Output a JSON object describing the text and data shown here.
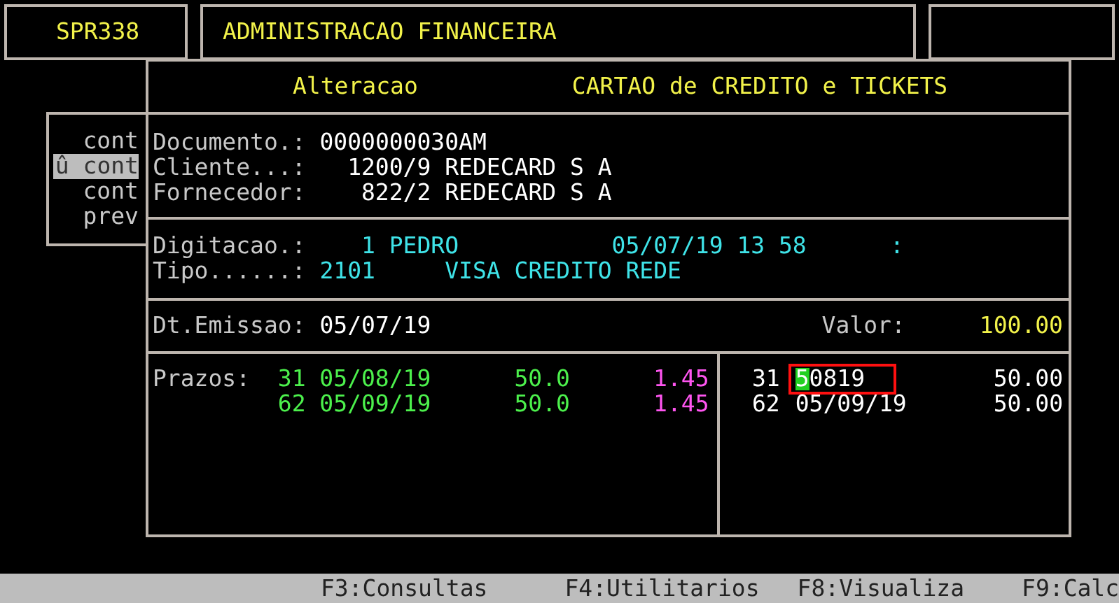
{
  "header": {
    "program_code": "SPR338",
    "system_title": "ADMINISTRACAO FINANCEIRA"
  },
  "background_menu": {
    "items": [
      {
        "text": "cont",
        "selected": false
      },
      {
        "text": "û cont",
        "selected": true
      },
      {
        "text": "cont",
        "selected": false
      },
      {
        "text": "prev",
        "selected": false
      }
    ]
  },
  "dialog": {
    "mode": "Alteracao",
    "title": "CARTAO de CREDITO e TICKETS",
    "parties": [
      {
        "label": "Documento.:",
        "code": "0000000030AM"
      },
      {
        "label": "Cliente...:",
        "code": "1200/9",
        "name": "REDECARD S A"
      },
      {
        "label": "Fornecedor:",
        "code": "822/2",
        "name": "REDECARD S A"
      }
    ],
    "entry": {
      "label": "Digitacao.:",
      "user_code": "1",
      "user_name": "PEDRO",
      "datetime": "05/07/19 13 58",
      "separator": ":"
    },
    "type": {
      "label": "Tipo......:",
      "code": "2101",
      "description": "VISA CREDITO REDE"
    },
    "issue": {
      "label": "Dt.Emissao:",
      "date": "05/07/19",
      "value_label": "Valor:",
      "value": "100.00"
    },
    "terms": {
      "label": "Prazos:",
      "rows": [
        {
          "days": "31",
          "date": "05/08/19",
          "amount": "50.0",
          "rate": "1.45"
        },
        {
          "days": "62",
          "date": "05/09/19",
          "amount": "50.0",
          "rate": "1.45"
        }
      ]
    },
    "installments": [
      {
        "days": "31",
        "date": "50819",
        "amount": "50.00",
        "editing": true
      },
      {
        "days": "62",
        "date": "05/09/19",
        "amount": "50.00",
        "editing": false
      }
    ]
  },
  "function_keys": [
    "F3:Consultas",
    "F4:Utilitarios",
    "F8:Visualiza",
    "F9:Calc"
  ]
}
